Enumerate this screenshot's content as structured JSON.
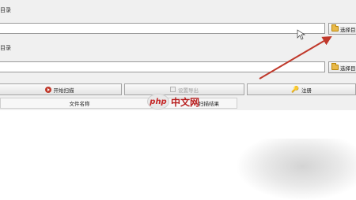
{
  "section1": {
    "label": "目录",
    "input_value": "",
    "browse_label": "选择目录"
  },
  "section2": {
    "label": "目录",
    "input_value": "",
    "browse_label": "选择目录"
  },
  "buttons": {
    "start_scan": "开始扫描",
    "export": "设置导出",
    "register": "注册"
  },
  "table": {
    "columns": [
      "文件名称",
      "扫描结果"
    ]
  },
  "watermark": {
    "text": "中文网",
    "logo": "php"
  },
  "colors": {
    "accent_arrow": "#c0392b",
    "folder": "#e9b949",
    "watermark": "#b71c1c"
  },
  "icons": [
    "folder-icon",
    "start-scan-icon",
    "export-icon",
    "key-icon",
    "cursor-icon"
  ]
}
